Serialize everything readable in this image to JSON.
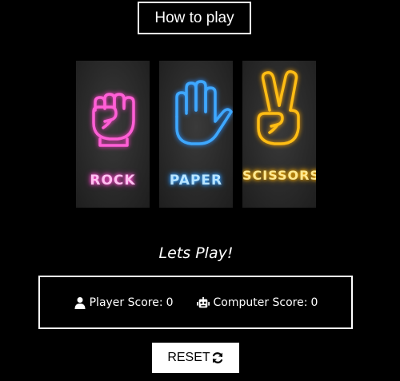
{
  "header": {
    "how_to_play_label": "How to play"
  },
  "choices": [
    {
      "label": "ROCK",
      "icon": "fist-icon",
      "color": "#ff4fd0"
    },
    {
      "label": "PAPER",
      "icon": "open-hand-icon",
      "color": "#3aa6ff"
    },
    {
      "label": "SCISSORS",
      "icon": "peace-hand-icon",
      "color": "#ffb400"
    }
  ],
  "status_text": "Lets Play!",
  "scores": {
    "player_label": "Player Score:",
    "player_value": "0",
    "player_icon": "user-icon",
    "computer_label": "Computer Score:",
    "computer_value": "0",
    "computer_icon": "robot-icon"
  },
  "reset": {
    "label": "RESET",
    "icon": "refresh-icon"
  }
}
